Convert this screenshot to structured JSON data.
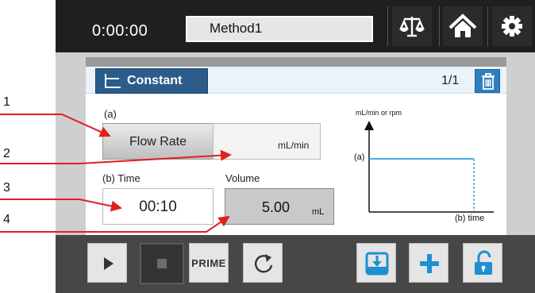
{
  "header": {
    "timer": "0:00:00",
    "method_name": "Method1",
    "icons": [
      "balance-icon",
      "home-icon",
      "gear-icon"
    ]
  },
  "panel": {
    "mode_label": "Constant",
    "step_counter": "1/1",
    "flow_label": "(a)",
    "flow_button": "Flow Rate",
    "flow_unit": "mL/min",
    "time_label": "(b) Time",
    "time_value": "00:10",
    "volume_label": "Volume",
    "volume_value": "5.00",
    "volume_unit": "mL",
    "graph": {
      "y_axis_label": "mL/min or rpm",
      "y_marker": "(a)",
      "x_marker": "(b) time"
    }
  },
  "footer": {
    "prime_label": "PRIME"
  },
  "callouts": [
    "1",
    "2",
    "3",
    "4"
  ],
  "colors": {
    "accent_blue": "#2f7fbf",
    "tab_blue": "#2b5c8a",
    "callout_red": "#e02020",
    "graph_line": "#29a3dc"
  }
}
